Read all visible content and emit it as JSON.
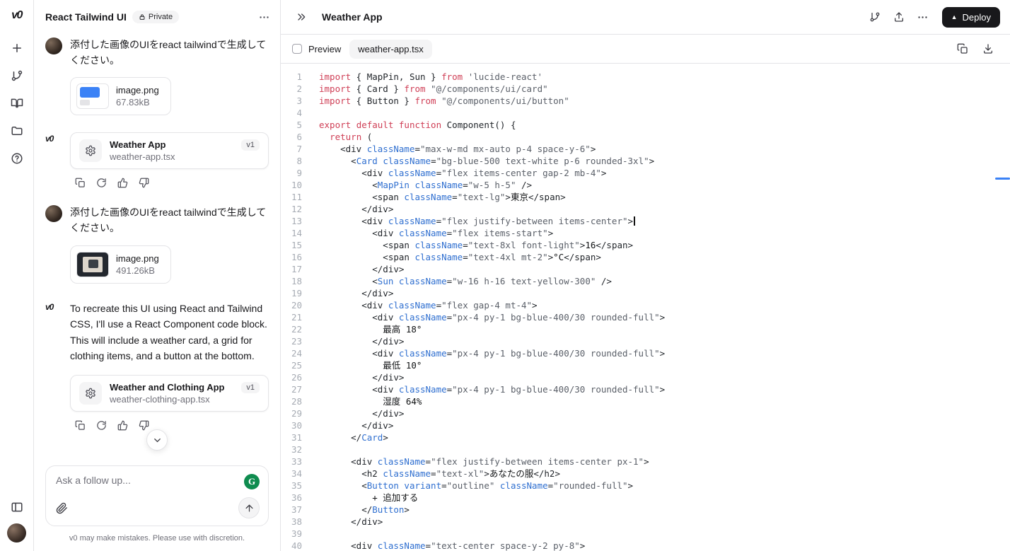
{
  "colors": {
    "tok-keyword": "#cf3e55",
    "tok-attr": "#2f6fd0",
    "tok-component": "#2f6fd0",
    "tok-string": "#5b6069",
    "tok-plain": "#1f2328",
    "tok-text": "#101214",
    "line-number": "#a6abb3",
    "scroll-mark": "#3b82f6",
    "deploy-bg": "#18181b",
    "grammarly-green": "#0f8c4f"
  },
  "chat": {
    "title": "React Tailwind UI",
    "privacy": "Private",
    "message1": {
      "text": "添付した画像のUIをreact tailwindで生成してください。",
      "attachment": {
        "name": "image.png",
        "size": "67.83kB"
      }
    },
    "card1": {
      "title": "Weather App",
      "file": "weather-app.tsx",
      "version": "v1"
    },
    "message2": {
      "text": "添付した画像のUIをreact tailwindで生成してください。",
      "attachment": {
        "name": "image.png",
        "size": "491.26kB"
      }
    },
    "assistant_text": "To recreate this UI using React and Tailwind CSS, I'll use a React Component code block. This will include a weather card, a grid for clothing items, and a button at the bottom.",
    "card2": {
      "title": "Weather and Clothing App",
      "file": "weather-clothing-app.tsx",
      "version": "v1"
    },
    "input_placeholder": "Ask a follow up...",
    "disclaimer": "v0 may make mistakes. Please use with discretion."
  },
  "main": {
    "title": "Weather App",
    "deploy_label": "Deploy",
    "preview_label": "Preview",
    "file_tab": "weather-app.tsx",
    "code": {
      "lines": [
        {
          "n": 1,
          "s": [
            [
              "k",
              "import"
            ],
            [
              "p",
              " { MapPin, Sun } "
            ],
            [
              "k",
              "from"
            ],
            [
              "s",
              " 'lucide-react'"
            ]
          ]
        },
        {
          "n": 2,
          "s": [
            [
              "k",
              "import"
            ],
            [
              "p",
              " { Card } "
            ],
            [
              "k",
              "from"
            ],
            [
              "s",
              " \"@/components/ui/card\""
            ]
          ]
        },
        {
          "n": 3,
          "s": [
            [
              "k",
              "import"
            ],
            [
              "p",
              " { Button } "
            ],
            [
              "k",
              "from"
            ],
            [
              "s",
              " \"@/components/ui/button\""
            ]
          ]
        },
        {
          "n": 4,
          "s": []
        },
        {
          "n": 5,
          "s": [
            [
              "k",
              "export"
            ],
            [
              "p",
              " "
            ],
            [
              "k",
              "default"
            ],
            [
              "p",
              " "
            ],
            [
              "k",
              "function"
            ],
            [
              "p",
              " Component() {"
            ]
          ]
        },
        {
          "n": 6,
          "s": [
            [
              "p",
              "  "
            ],
            [
              "k",
              "return"
            ],
            [
              "p",
              " ("
            ]
          ]
        },
        {
          "n": 7,
          "s": [
            [
              "p",
              "    <div "
            ],
            [
              "a",
              "className"
            ],
            [
              "p",
              "="
            ],
            [
              "s",
              "\"max-w-md mx-auto p-4 space-y-6\""
            ],
            [
              "p",
              ">"
            ]
          ]
        },
        {
          "n": 8,
          "s": [
            [
              "p",
              "      <"
            ],
            [
              "c",
              "Card"
            ],
            [
              "p",
              " "
            ],
            [
              "a",
              "className"
            ],
            [
              "p",
              "="
            ],
            [
              "s",
              "\"bg-blue-500 text-white p-6 rounded-3xl\""
            ],
            [
              "p",
              ">"
            ]
          ]
        },
        {
          "n": 9,
          "s": [
            [
              "p",
              "        <div "
            ],
            [
              "a",
              "className"
            ],
            [
              "p",
              "="
            ],
            [
              "s",
              "\"flex items-center gap-2 mb-4\""
            ],
            [
              "p",
              ">"
            ]
          ]
        },
        {
          "n": 10,
          "s": [
            [
              "p",
              "          <"
            ],
            [
              "c",
              "MapPin"
            ],
            [
              "p",
              " "
            ],
            [
              "a",
              "className"
            ],
            [
              "p",
              "="
            ],
            [
              "s",
              "\"w-5 h-5\""
            ],
            [
              "p",
              " />"
            ]
          ]
        },
        {
          "n": 11,
          "s": [
            [
              "p",
              "          <span "
            ],
            [
              "a",
              "className"
            ],
            [
              "p",
              "="
            ],
            [
              "s",
              "\"text-lg\""
            ],
            [
              "p",
              ">"
            ],
            [
              "t",
              "東京"
            ],
            [
              "p",
              "</span>"
            ]
          ]
        },
        {
          "n": 12,
          "s": [
            [
              "p",
              "        </div>"
            ]
          ]
        },
        {
          "n": 13,
          "cursor": true,
          "s": [
            [
              "p",
              "        <div "
            ],
            [
              "a",
              "className"
            ],
            [
              "p",
              "="
            ],
            [
              "s",
              "\"flex justify-between items-center\""
            ],
            [
              "p",
              ">"
            ]
          ]
        },
        {
          "n": 14,
          "s": [
            [
              "p",
              "          <div "
            ],
            [
              "a",
              "className"
            ],
            [
              "p",
              "="
            ],
            [
              "s",
              "\"flex items-start\""
            ],
            [
              "p",
              ">"
            ]
          ]
        },
        {
          "n": 15,
          "s": [
            [
              "p",
              "            <span "
            ],
            [
              "a",
              "className"
            ],
            [
              "p",
              "="
            ],
            [
              "s",
              "\"text-8xl font-light\""
            ],
            [
              "p",
              ">"
            ],
            [
              "t",
              "16"
            ],
            [
              "p",
              "</span>"
            ]
          ]
        },
        {
          "n": 16,
          "s": [
            [
              "p",
              "            <span "
            ],
            [
              "a",
              "className"
            ],
            [
              "p",
              "="
            ],
            [
              "s",
              "\"text-4xl mt-2\""
            ],
            [
              "p",
              ">"
            ],
            [
              "t",
              "°C"
            ],
            [
              "p",
              "</span>"
            ]
          ]
        },
        {
          "n": 17,
          "s": [
            [
              "p",
              "          </div>"
            ]
          ]
        },
        {
          "n": 18,
          "s": [
            [
              "p",
              "          <"
            ],
            [
              "c",
              "Sun"
            ],
            [
              "p",
              " "
            ],
            [
              "a",
              "className"
            ],
            [
              "p",
              "="
            ],
            [
              "s",
              "\"w-16 h-16 text-yellow-300\""
            ],
            [
              "p",
              " />"
            ]
          ]
        },
        {
          "n": 19,
          "s": [
            [
              "p",
              "        </div>"
            ]
          ]
        },
        {
          "n": 20,
          "s": [
            [
              "p",
              "        <div "
            ],
            [
              "a",
              "className"
            ],
            [
              "p",
              "="
            ],
            [
              "s",
              "\"flex gap-4 mt-4\""
            ],
            [
              "p",
              ">"
            ]
          ]
        },
        {
          "n": 21,
          "s": [
            [
              "p",
              "          <div "
            ],
            [
              "a",
              "className"
            ],
            [
              "p",
              "="
            ],
            [
              "s",
              "\"px-4 py-1 bg-blue-400/30 rounded-full\""
            ],
            [
              "p",
              ">"
            ]
          ]
        },
        {
          "n": 22,
          "s": [
            [
              "t",
              "            最高 18°"
            ]
          ]
        },
        {
          "n": 23,
          "s": [
            [
              "p",
              "          </div>"
            ]
          ]
        },
        {
          "n": 24,
          "s": [
            [
              "p",
              "          <div "
            ],
            [
              "a",
              "className"
            ],
            [
              "p",
              "="
            ],
            [
              "s",
              "\"px-4 py-1 bg-blue-400/30 rounded-full\""
            ],
            [
              "p",
              ">"
            ]
          ]
        },
        {
          "n": 25,
          "s": [
            [
              "t",
              "            最低 10°"
            ]
          ]
        },
        {
          "n": 26,
          "s": [
            [
              "p",
              "          </div>"
            ]
          ]
        },
        {
          "n": 27,
          "s": [
            [
              "p",
              "          <div "
            ],
            [
              "a",
              "className"
            ],
            [
              "p",
              "="
            ],
            [
              "s",
              "\"px-4 py-1 bg-blue-400/30 rounded-full\""
            ],
            [
              "p",
              ">"
            ]
          ]
        },
        {
          "n": 28,
          "s": [
            [
              "t",
              "            湿度 64%"
            ]
          ]
        },
        {
          "n": 29,
          "s": [
            [
              "p",
              "          </div>"
            ]
          ]
        },
        {
          "n": 30,
          "s": [
            [
              "p",
              "        </div>"
            ]
          ]
        },
        {
          "n": 31,
          "s": [
            [
              "p",
              "      </"
            ],
            [
              "c",
              "Card"
            ],
            [
              "p",
              ">"
            ]
          ]
        },
        {
          "n": 32,
          "s": []
        },
        {
          "n": 33,
          "s": [
            [
              "p",
              "      <div "
            ],
            [
              "a",
              "className"
            ],
            [
              "p",
              "="
            ],
            [
              "s",
              "\"flex justify-between items-center px-1\""
            ],
            [
              "p",
              ">"
            ]
          ]
        },
        {
          "n": 34,
          "s": [
            [
              "p",
              "        <h2 "
            ],
            [
              "a",
              "className"
            ],
            [
              "p",
              "="
            ],
            [
              "s",
              "\"text-xl\""
            ],
            [
              "p",
              ">"
            ],
            [
              "t",
              "あなたの服"
            ],
            [
              "p",
              "</h2>"
            ]
          ]
        },
        {
          "n": 35,
          "s": [
            [
              "p",
              "        <"
            ],
            [
              "c",
              "Button"
            ],
            [
              "p",
              " "
            ],
            [
              "a",
              "variant"
            ],
            [
              "p",
              "="
            ],
            [
              "s",
              "\"outline\""
            ],
            [
              "p",
              " "
            ],
            [
              "a",
              "className"
            ],
            [
              "p",
              "="
            ],
            [
              "s",
              "\"rounded-full\""
            ],
            [
              "p",
              ">"
            ]
          ]
        },
        {
          "n": 36,
          "s": [
            [
              "t",
              "          + 追加する"
            ]
          ]
        },
        {
          "n": 37,
          "s": [
            [
              "p",
              "        </"
            ],
            [
              "c",
              "Button"
            ],
            [
              "p",
              ">"
            ]
          ]
        },
        {
          "n": 38,
          "s": [
            [
              "p",
              "      </div>"
            ]
          ]
        },
        {
          "n": 39,
          "s": []
        },
        {
          "n": 40,
          "s": [
            [
              "p",
              "      <div "
            ],
            [
              "a",
              "className"
            ],
            [
              "p",
              "="
            ],
            [
              "s",
              "\"text-center space-y-2 py-8\""
            ],
            [
              "p",
              ">"
            ]
          ]
        }
      ]
    }
  }
}
